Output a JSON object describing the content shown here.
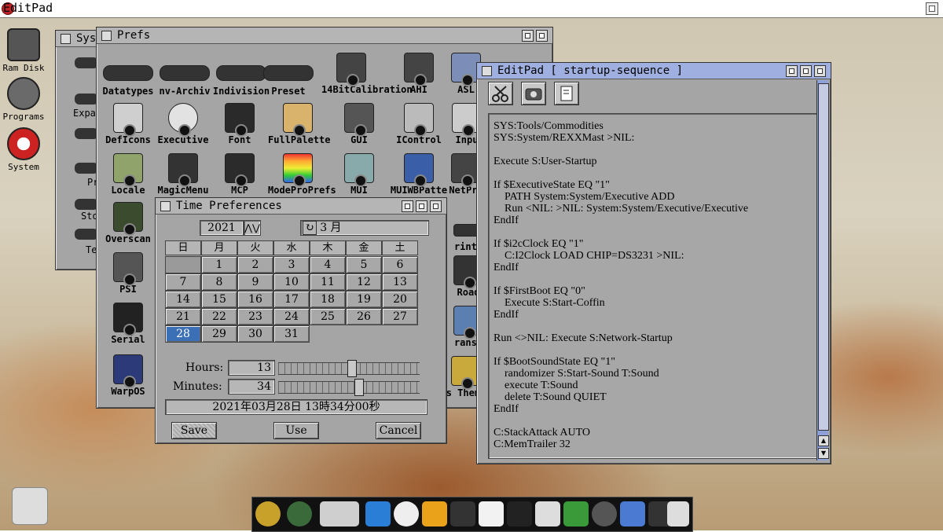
{
  "screen": {
    "title": "EditPad"
  },
  "desktop_icons": [
    {
      "label": "Ram Disk"
    },
    {
      "label": "Programs"
    },
    {
      "label": "System"
    }
  ],
  "sys_window": {
    "title": "Sys",
    "partial_labels": [
      "Expa",
      "Pr",
      "Sto",
      "Te"
    ]
  },
  "prefs_window": {
    "title": "Prefs",
    "icons": [
      "Datatypes",
      "nv-Archiv",
      "Indivision",
      "Preset",
      "14BitCalibration",
      "AHI",
      "ASL",
      "DefIcons",
      "Executive",
      "Font",
      "FullPalette",
      "GUI",
      "IControl",
      "Inpu",
      "Locale",
      "MagicMenu",
      "MCP",
      "ModeProPrefs",
      "MUI",
      "MUIWBPatte",
      "NetPri",
      "Overscan",
      "PSI",
      "Serial",
      "WarpOS",
      "rinte",
      "Road",
      "ransl",
      "s Theme"
    ]
  },
  "time_window": {
    "title": "Time Preferences",
    "year": "2021",
    "month": "3 月",
    "weekdays": [
      "日",
      "月",
      "火",
      "水",
      "木",
      "金",
      "土"
    ],
    "days": [
      "1",
      "2",
      "3",
      "4",
      "5",
      "6",
      "7",
      "8",
      "9",
      "10",
      "11",
      "12",
      "13",
      "14",
      "15",
      "16",
      "17",
      "18",
      "19",
      "20",
      "21",
      "22",
      "23",
      "24",
      "25",
      "26",
      "27",
      "28",
      "29",
      "30",
      "31"
    ],
    "selected_day": "28",
    "hours_label": "Hours:",
    "hours_value": "13",
    "hours_level": 0.52,
    "minutes_label": "Minutes:",
    "minutes_value": "34",
    "minutes_level": 0.57,
    "datetime_text": "2021年03月28日 13時34分00秒",
    "save_label": "Save",
    "use_label": "Use",
    "cancel_label": "Cancel"
  },
  "editpad_window": {
    "title": "EditPad [ startup-sequence ]",
    "lines": [
      "SYS:Tools/Commodities",
      "SYS:System/REXXMast >NIL:",
      "",
      "Execute S:User-Startup",
      "",
      "If $ExecutiveState EQ \"1\"",
      "    PATH System:System/Executive ADD",
      "    Run <NIL: >NIL: System:System/Executive/Executive",
      "EndIf",
      "",
      "If $i2cClock EQ \"1\"",
      "    C:I2Clock LOAD CHIP=DS3231 >NIL:",
      "EndIf",
      "",
      "If $FirstBoot EQ \"0\"",
      "    Execute S:Start-Coffin",
      "EndIf",
      "",
      "Run <>NIL: Execute S:Network-Startup",
      "",
      "If $BootSoundState EQ \"1\"",
      "    randomizer S:Start-Sound T:Sound",
      "    execute T:Sound",
      "    delete T:Sound QUIET",
      "EndIf",
      "",
      "C:StackAttack AUTO",
      "C:MemTrailer 32"
    ]
  },
  "colors": {
    "selection": "#3b6fb6",
    "window": "#a5a5a5",
    "active_title": "#9fb0e0"
  }
}
